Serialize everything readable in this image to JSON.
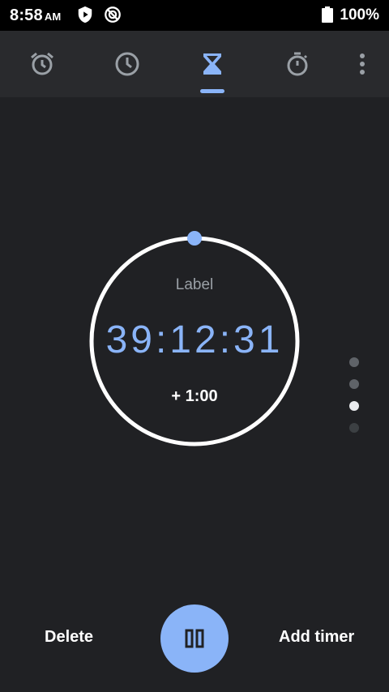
{
  "status_bar": {
    "time": "8:58",
    "ampm": "AM",
    "battery": "100%",
    "icons": [
      "play-protect-icon",
      "do-not-disturb-icon",
      "battery-icon"
    ]
  },
  "tabs": [
    {
      "name": "alarm",
      "icon": "alarm-icon",
      "active": false
    },
    {
      "name": "clock",
      "icon": "clock-icon",
      "active": false
    },
    {
      "name": "timer",
      "icon": "hourglass-icon",
      "active": true
    },
    {
      "name": "stopwatch",
      "icon": "stopwatch-icon",
      "active": false
    }
  ],
  "timer": {
    "label": "Label",
    "time": "39:12:31",
    "add_minute": "+ 1:00",
    "progress": 0.0
  },
  "page_indicator": {
    "count": 4,
    "active_index": 2
  },
  "actions": {
    "delete_label": "Delete",
    "add_timer_label": "Add timer",
    "fab_icon": "pause-icon"
  },
  "colors": {
    "background": "#202124",
    "accent": "#8ab4f8",
    "tab_bar": "#292a2d",
    "status_bar": "#000000"
  }
}
